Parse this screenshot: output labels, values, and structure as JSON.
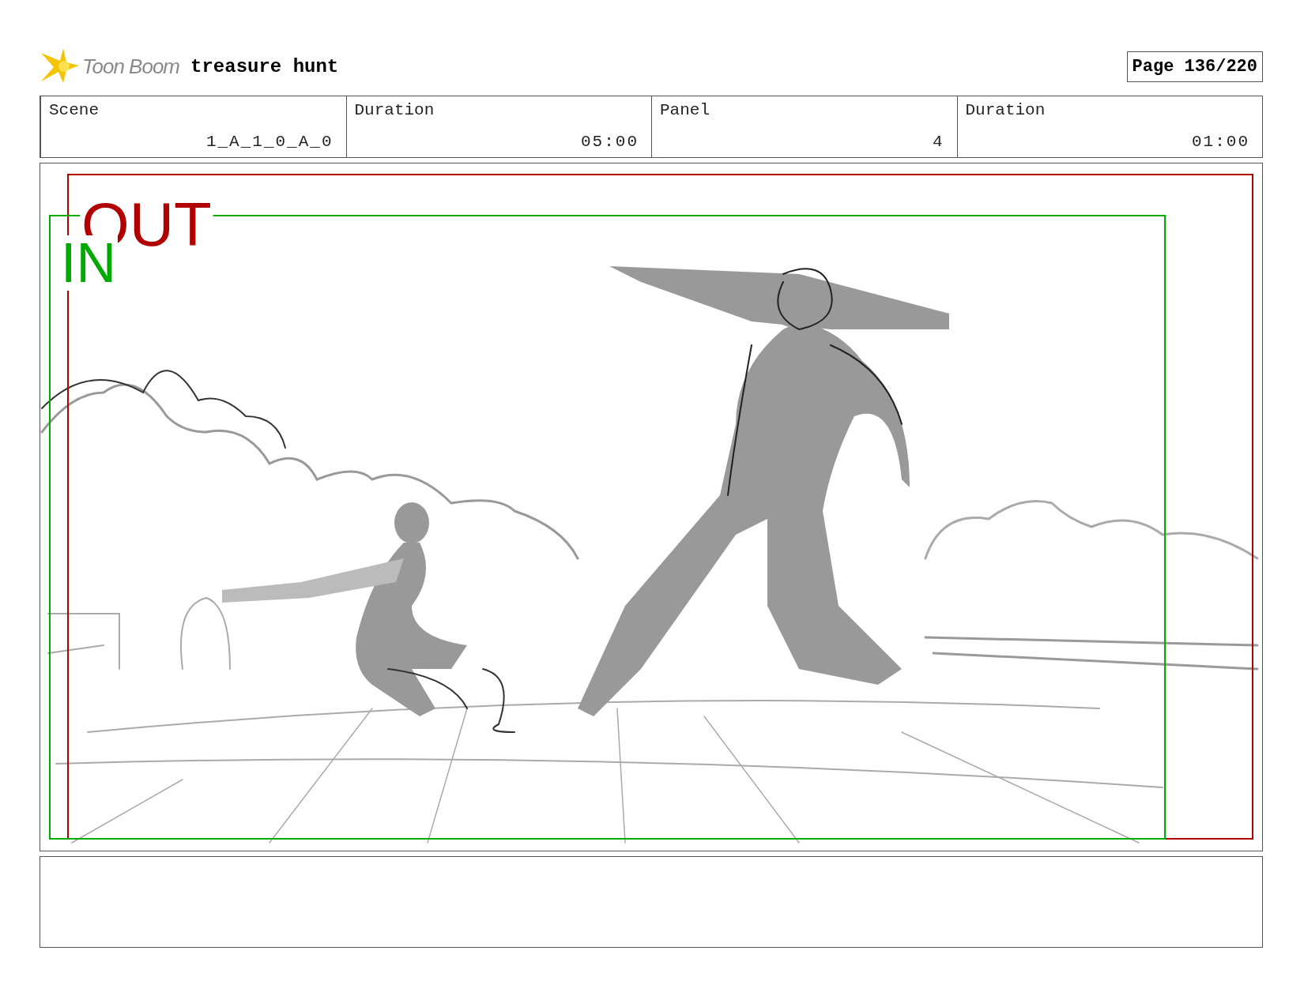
{
  "header": {
    "logo": "Toon Boom",
    "title": "treasure hunt",
    "page": "Page 136/220"
  },
  "fields": [
    {
      "label": "Scene",
      "value": "1_A_1_0_A_0"
    },
    {
      "label": "Duration",
      "value": "05:00"
    },
    {
      "label": "Panel",
      "value": "4"
    },
    {
      "label": "Duration",
      "value": "01:00"
    }
  ],
  "panel": {
    "camera_frames": [
      {
        "label": "OUT",
        "color": "#b00000"
      },
      {
        "label": "IN",
        "color": "#00aa00"
      }
    ]
  }
}
